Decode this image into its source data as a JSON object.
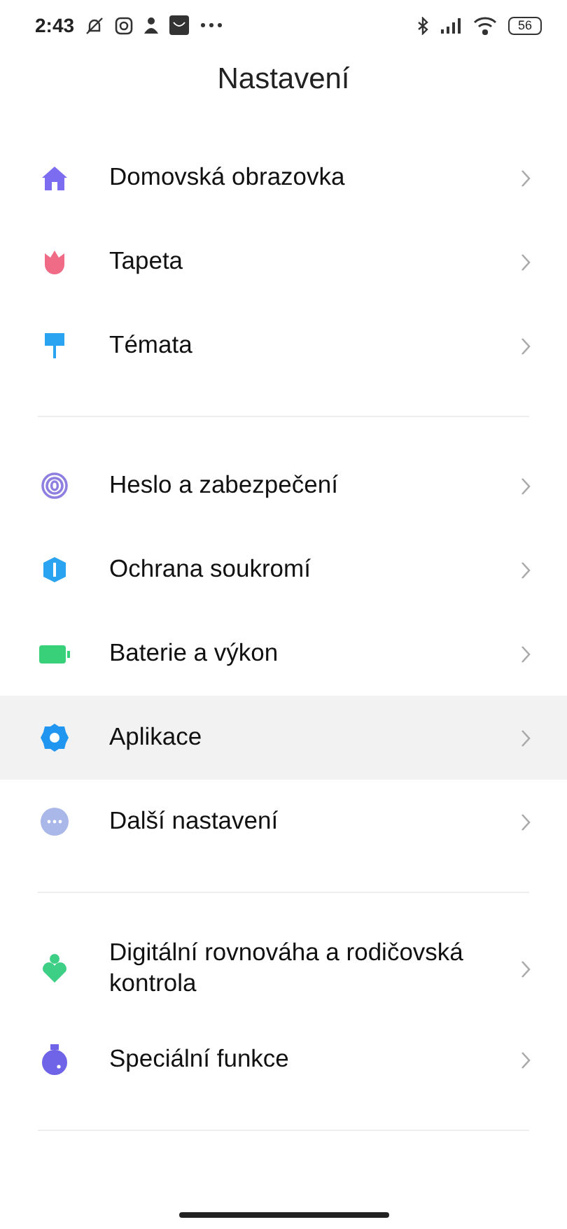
{
  "status_bar": {
    "time": "2:43",
    "battery": "56"
  },
  "title": "Nastavení",
  "groups": [
    {
      "items": [
        {
          "label": "Domovská obrazovka",
          "selected": false
        },
        {
          "label": "Tapeta",
          "selected": false
        },
        {
          "label": "Témata",
          "selected": false
        }
      ]
    },
    {
      "items": [
        {
          "label": "Heslo a zabezpečení",
          "selected": false
        },
        {
          "label": "Ochrana soukromí",
          "selected": false
        },
        {
          "label": "Baterie a výkon",
          "selected": false
        },
        {
          "label": "Aplikace",
          "selected": true
        },
        {
          "label": "Další nastavení",
          "selected": false
        }
      ]
    },
    {
      "items": [
        {
          "label": "Digitální rovnováha a rodičovská kontrola",
          "selected": false
        },
        {
          "label": "Speciální funkce",
          "selected": false
        }
      ]
    }
  ]
}
